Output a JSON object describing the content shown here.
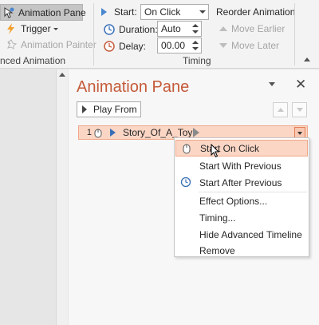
{
  "ribbon": {
    "animation_pane": "Animation Pane",
    "trigger": "Trigger",
    "animation_painter": "Animation Painter",
    "group_advanced": "nced Animation",
    "start_label": "Start:",
    "start_value": "On Click",
    "duration_label": "Duration:",
    "duration_value": "Auto",
    "delay_label": "Delay:",
    "delay_value": "00.00",
    "reorder_title": "Reorder Animation",
    "move_earlier": "Move Earlier",
    "move_later": "Move Later",
    "group_timing": "Timing"
  },
  "pane": {
    "title": "Animation Pane",
    "play_from": "Play From",
    "row": {
      "number": "1",
      "name": "Story_Of_A_Toy"
    }
  },
  "menu": {
    "items": [
      "Start On Click",
      "Start With Previous",
      "Start After Previous",
      "Effect Options...",
      "Timing...",
      "Hide Advanced Timeline",
      "Remove"
    ],
    "highlighted_index": 0
  },
  "colors": {
    "accent": "#c55a3a",
    "highlight_bg": "#fbd6c5",
    "highlight_border": "#f0a888"
  }
}
